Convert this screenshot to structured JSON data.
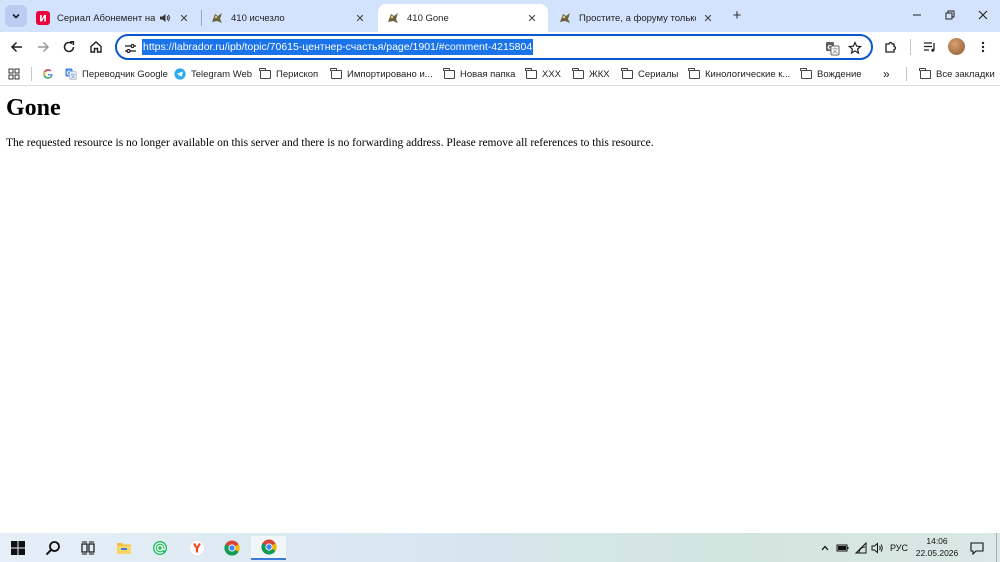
{
  "browser": {
    "tabs": [
      {
        "title": "Сериал Абонемент на расследование",
        "active": false,
        "audio": true
      },
      {
        "title": "410 исчезло",
        "active": false,
        "audio": false
      },
      {
        "title": "410 Gone",
        "active": true,
        "audio": false
      },
      {
        "title": "Простите, а форуму только у меня",
        "active": false,
        "audio": false
      }
    ],
    "address": {
      "url": "https://labrador.ru/ipb/topic/70615-центнер-счастья/page/1901/#comment-4215804",
      "selected": true
    },
    "bookmarks": [
      {
        "label": "",
        "icon": "google-icon"
      },
      {
        "label": "Переводчик Google",
        "icon": "translate-icon"
      },
      {
        "label": "Telegram Web",
        "icon": "telegram-icon"
      },
      {
        "label": "Перископ",
        "icon": "folder-icon"
      },
      {
        "label": "Импортировано и...",
        "icon": "folder-icon"
      },
      {
        "label": "Новая папка",
        "icon": "folder-icon"
      },
      {
        "label": "XXX",
        "icon": "folder-icon"
      },
      {
        "label": "ЖКХ",
        "icon": "folder-icon"
      },
      {
        "label": "Сериалы",
        "icon": "folder-icon"
      },
      {
        "label": "Кинологические к...",
        "icon": "folder-icon"
      },
      {
        "label": "Вождение",
        "icon": "folder-icon"
      }
    ],
    "all_bookmarks_label": "Все закладки",
    "accent": "#0b57d0",
    "tabstrip_color": "#d3e3fd"
  },
  "page": {
    "heading": "Gone",
    "message": "The requested resource is no longer available on this server and there is no forwarding address. Please remove all references to this resource."
  },
  "taskbar": {
    "apps": [
      "windows-start-icon",
      "search-icon",
      "task-view-icon",
      "file-explorer-icon",
      "mail-at-icon",
      "yandex-browser-icon",
      "chrome-icon",
      "chrome-icon"
    ],
    "language": "РУС",
    "time": "14:06",
    "date": "22.05.2026"
  }
}
